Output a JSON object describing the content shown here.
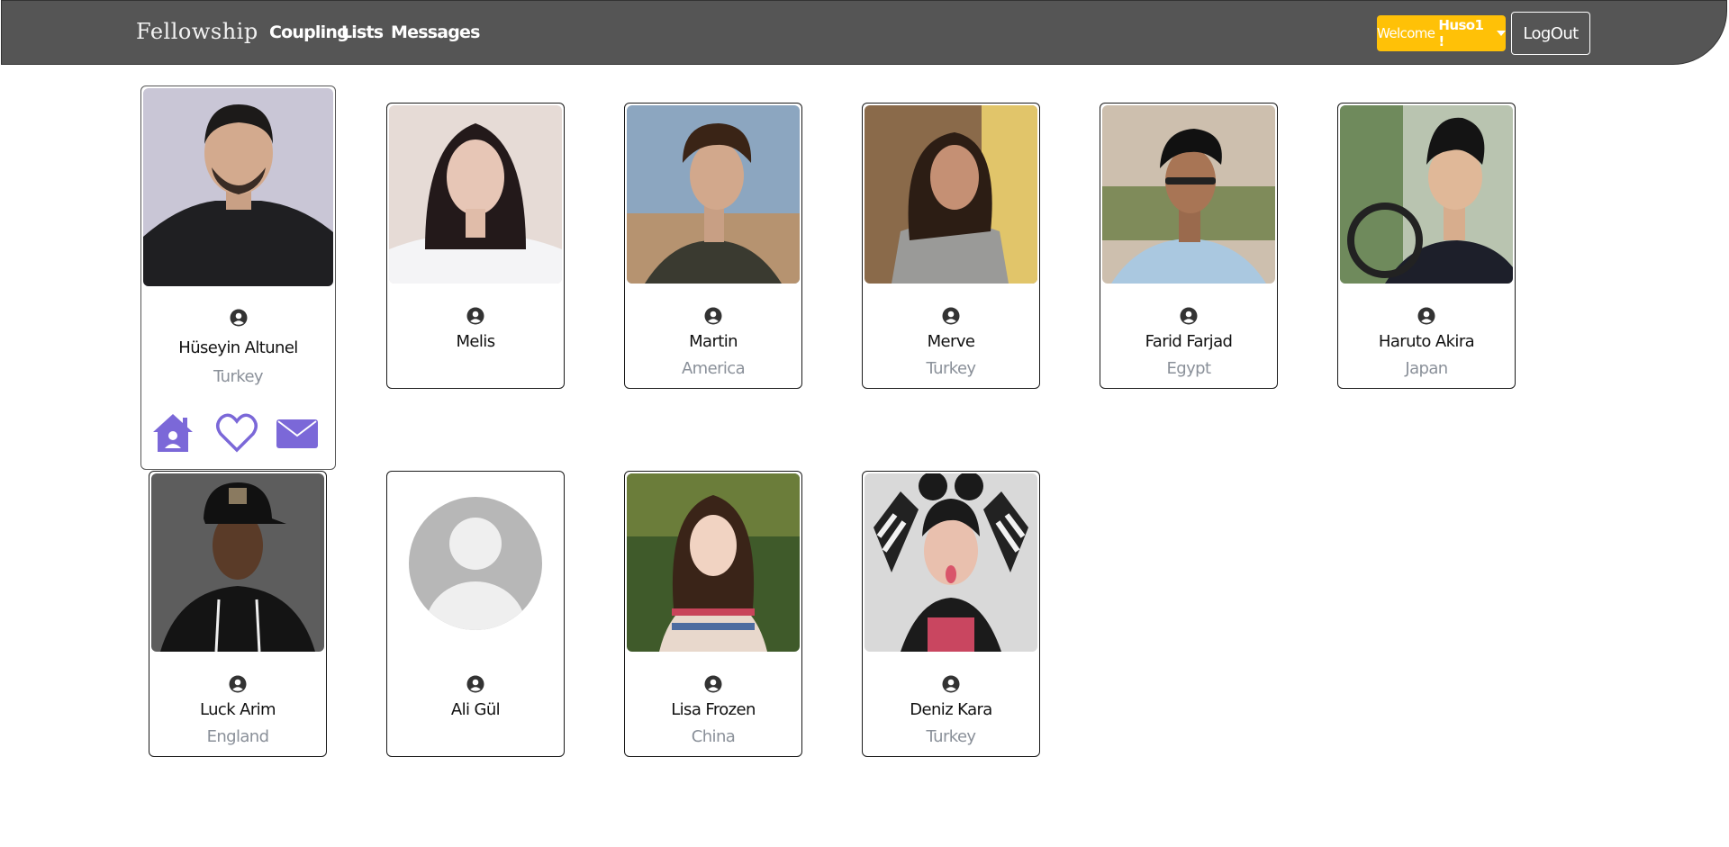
{
  "navbar": {
    "brand": "Fellowship",
    "links": [
      "Coupling",
      "Lists",
      "Messages"
    ],
    "welcome_prefix": "Welcome",
    "welcome_user": "Huso1 !",
    "logout_label": "LogOut"
  },
  "colors": {
    "navbar_bg": "#555555",
    "welcome_btn": "#ffc107",
    "action_icon": "#7b68d8",
    "country_text": "#8a9099"
  },
  "featured_profile": {
    "name": "Hüseyin Altunel",
    "country": "Turkey",
    "actions": [
      "home-icon",
      "heart-icon",
      "envelope-icon"
    ]
  },
  "profiles": [
    {
      "name": "Melis",
      "country": ""
    },
    {
      "name": "Martin",
      "country": "America"
    },
    {
      "name": "Merve",
      "country": "Turkey"
    },
    {
      "name": "Farid Farjad",
      "country": "Egypt"
    },
    {
      "name": "Haruto Akira",
      "country": "Japan"
    },
    {
      "name": "Luck Arim",
      "country": "England"
    },
    {
      "name": "Ali Gül",
      "country": ""
    },
    {
      "name": "Lisa Frozen",
      "country": "China"
    },
    {
      "name": "Deniz Kara",
      "country": "Turkey"
    }
  ]
}
